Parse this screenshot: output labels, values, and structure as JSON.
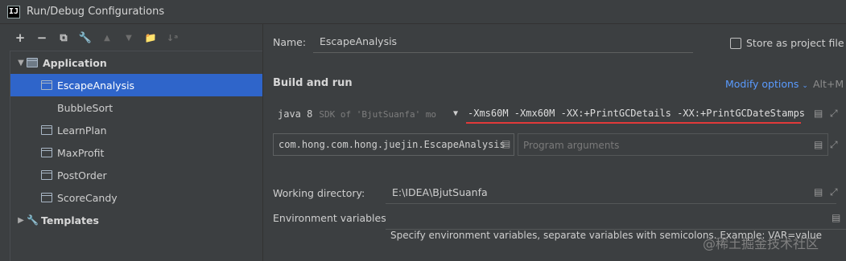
{
  "window": {
    "title": "Run/Debug Configurations",
    "app_icon_letter": "IJ"
  },
  "toolbar": {
    "buttons": [
      {
        "icon": "plus-icon",
        "glyph": "+"
      },
      {
        "icon": "minus-icon",
        "glyph": "−"
      },
      {
        "icon": "copy-icon",
        "glyph": "⧉"
      },
      {
        "icon": "wrench-icon",
        "glyph": "🔧"
      },
      {
        "icon": "move-up-icon",
        "glyph": "▲"
      },
      {
        "icon": "move-down-icon",
        "glyph": "▼"
      },
      {
        "icon": "folder-icon",
        "glyph": "📁"
      },
      {
        "icon": "sort-icon",
        "glyph": "↓ᵃ"
      }
    ]
  },
  "tree": {
    "application_label": "Application",
    "items": [
      {
        "label": "EscapeAnalysis",
        "selected": true
      },
      {
        "label": "BubbleSort",
        "selected": false
      },
      {
        "label": "LearnPlan",
        "selected": false
      },
      {
        "label": "MaxProfit",
        "selected": false
      },
      {
        "label": "PostOrder",
        "selected": false
      },
      {
        "label": "ScoreCandy",
        "selected": false
      }
    ],
    "templates_label": "Templates"
  },
  "form": {
    "name_label": "Name:",
    "name_value": "EscapeAnalysis",
    "store_label": "Store as project file",
    "section_title": "Build and run",
    "modify_options": "Modify options",
    "modify_shortcut": "Alt+M",
    "sdk_main": "java 8",
    "sdk_hint": "SDK of 'BjutSuanfa' mo",
    "vm_options": "-Xms60M -Xmx60M  -XX:+PrintGCDetails -XX:+PrintGCDateStamps",
    "main_class": "com.hong.com.hong.juejin.EscapeAnalysis",
    "program_args_placeholder": "Program arguments",
    "working_dir_label": "Working directory:",
    "working_dir_value": "E:\\IDEA\\BjutSuanfa",
    "env_label": "Environment variables:",
    "env_hint": "Specify environment variables, separate variables with semicolons. Example: VAR=value",
    "watermark": "@稀土掘金技术社区"
  },
  "colors": {
    "selection": "#2f65ca",
    "link": "#5a9bff",
    "underline": "#e23a3a"
  }
}
